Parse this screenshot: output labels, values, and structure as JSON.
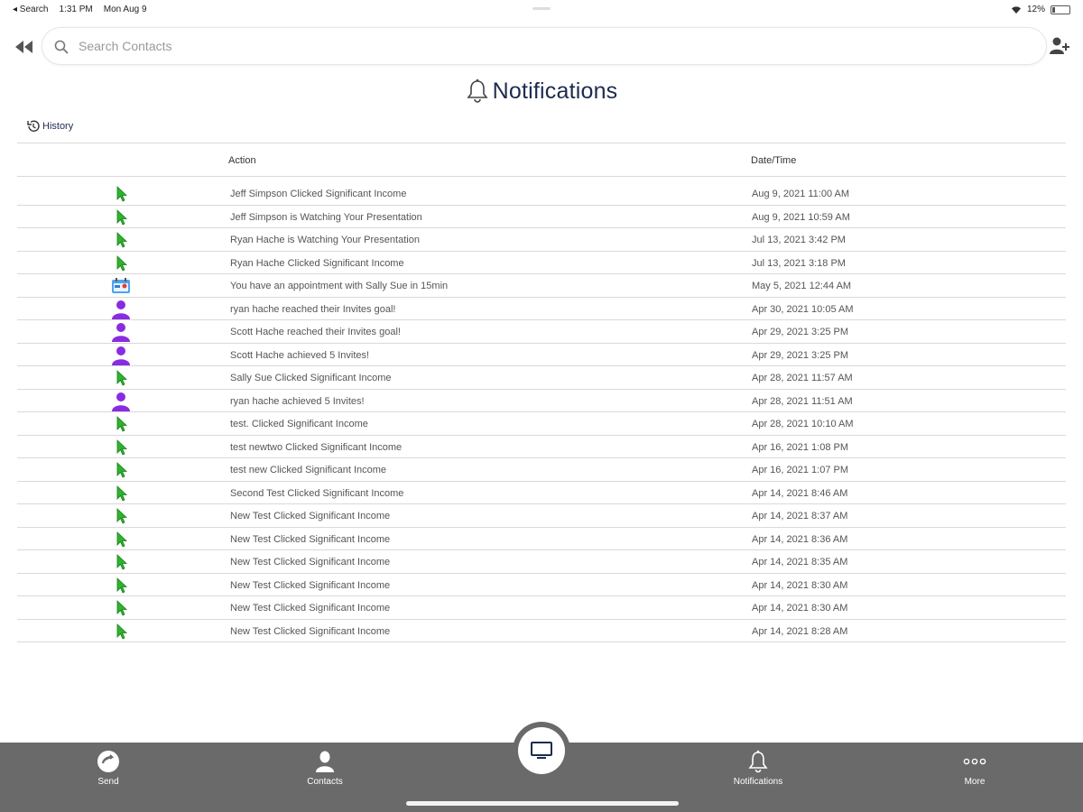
{
  "status_bar": {
    "back_app": "◂ Search",
    "time": "1:31 PM",
    "date": "Mon Aug 9",
    "battery": "12%"
  },
  "search": {
    "placeholder": "Search Contacts"
  },
  "page": {
    "title": "Notifications"
  },
  "history_label": "History",
  "table": {
    "col_action": "Action",
    "col_datetime": "Date/Time",
    "rows": [
      {
        "icon": "cursor-icon",
        "action": "Jeff Simpson Clicked Significant Income",
        "date": "Aug 9, 2021 11:00 AM"
      },
      {
        "icon": "cursor-icon",
        "action": "Jeff Simpson is Watching Your Presentation",
        "date": "Aug 9, 2021 10:59 AM"
      },
      {
        "icon": "cursor-icon",
        "action": "Ryan Hache is Watching Your Presentation",
        "date": "Jul 13, 2021 3:42 PM"
      },
      {
        "icon": "cursor-icon",
        "action": "Ryan Hache Clicked Significant Income",
        "date": "Jul 13, 2021 3:18 PM"
      },
      {
        "icon": "calendar-icon",
        "action": "You have an appointment with Sally Sue in 15min",
        "date": "May 5, 2021 12:44 AM"
      },
      {
        "icon": "person-icon",
        "action": "ryan hache reached their Invites goal!",
        "date": "Apr 30, 2021 10:05 AM"
      },
      {
        "icon": "person-icon",
        "action": "Scott Hache reached their Invites goal!",
        "date": "Apr 29, 2021 3:25 PM"
      },
      {
        "icon": "person-icon",
        "action": "Scott Hache achieved 5 Invites!",
        "date": "Apr 29, 2021 3:25 PM"
      },
      {
        "icon": "cursor-icon",
        "action": "Sally Sue Clicked Significant Income",
        "date": "Apr 28, 2021 11:57 AM"
      },
      {
        "icon": "person-icon",
        "action": "ryan hache achieved 5 Invites!",
        "date": "Apr 28, 2021 11:51 AM"
      },
      {
        "icon": "cursor-icon",
        "action": "test. Clicked Significant Income",
        "date": "Apr 28, 2021 10:10 AM"
      },
      {
        "icon": "cursor-icon",
        "action": "test newtwo Clicked Significant Income",
        "date": "Apr 16, 2021 1:08 PM"
      },
      {
        "icon": "cursor-icon",
        "action": "test new Clicked Significant Income",
        "date": "Apr 16, 2021 1:07 PM"
      },
      {
        "icon": "cursor-icon",
        "action": "Second Test Clicked Significant Income",
        "date": "Apr 14, 2021 8:46 AM"
      },
      {
        "icon": "cursor-icon",
        "action": "New Test Clicked Significant Income",
        "date": "Apr 14, 2021 8:37 AM"
      },
      {
        "icon": "cursor-icon",
        "action": "New Test Clicked Significant Income",
        "date": "Apr 14, 2021 8:36 AM"
      },
      {
        "icon": "cursor-icon",
        "action": "New Test Clicked Significant Income",
        "date": "Apr 14, 2021 8:35 AM"
      },
      {
        "icon": "cursor-icon",
        "action": "New Test Clicked Significant Income",
        "date": "Apr 14, 2021 8:30 AM"
      },
      {
        "icon": "cursor-icon",
        "action": "New Test Clicked Significant Income",
        "date": "Apr 14, 2021 8:30 AM"
      },
      {
        "icon": "cursor-icon",
        "action": "New Test Clicked Significant Income",
        "date": "Apr 14, 2021 8:28 AM"
      }
    ]
  },
  "tabbar": {
    "send": "Send",
    "contacts": "Contacts",
    "notifications": "Notifications",
    "more": "More"
  },
  "colors": {
    "title": "#1d2b4f",
    "cursor_green": "#2bb52b",
    "person_purple": "#8a2be2",
    "tabbar_bg": "#6a6a6a"
  }
}
